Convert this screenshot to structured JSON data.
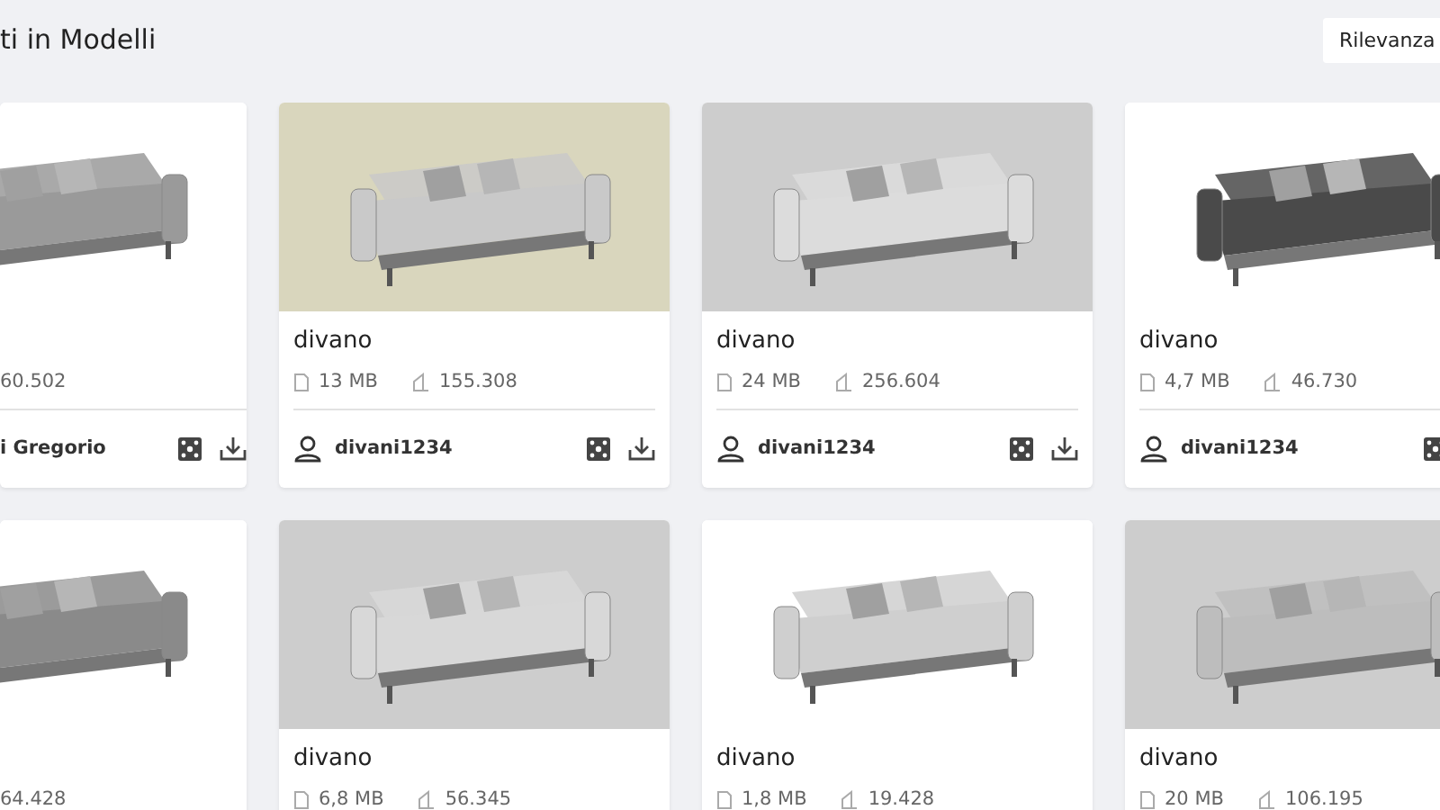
{
  "header": {
    "title": "ti in Modelli",
    "sort": "Rilevanza"
  },
  "models": [
    {
      "kind": "partial",
      "triangles": "60.502",
      "author": "i Gregorio"
    },
    {
      "kind": "full",
      "title": "divano",
      "size": "13 MB",
      "triangles": "155.308",
      "author": "divani1234"
    },
    {
      "kind": "full",
      "title": "divano",
      "size": "24 MB",
      "triangles": "256.604",
      "author": "divani1234"
    },
    {
      "kind": "full",
      "title": "divano",
      "size": "4,7 MB",
      "triangles": "46.730",
      "author": "divani1234"
    },
    {
      "kind": "partial",
      "triangles": "64.428"
    },
    {
      "kind": "full",
      "title": "divano",
      "size": "6,8 MB",
      "triangles": "56.345"
    },
    {
      "kind": "full",
      "title": "divano",
      "size": "1,8 MB",
      "triangles": "19.428"
    },
    {
      "kind": "full",
      "title": "divano",
      "size": "20 MB",
      "triangles": "106.195"
    }
  ]
}
